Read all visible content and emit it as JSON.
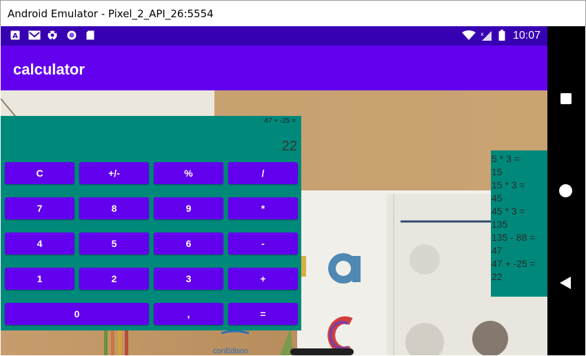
{
  "window": {
    "title": "Android Emulator - Pixel_2_API_26:5554"
  },
  "status_bar": {
    "time": "10:07",
    "icons": [
      "a-notification-icon",
      "mail-icon",
      "soccer-ball-icon",
      "circle-app-icon",
      "sd-card-icon",
      "wifi-icon",
      "no-signal-icon",
      "battery-icon"
    ]
  },
  "app_bar": {
    "title": "calculator"
  },
  "calculator": {
    "expression": "47 + -25 =",
    "result": "22",
    "buttons": {
      "clear": "C",
      "plus_minus": "+/-",
      "percent": "%",
      "divide": "/",
      "seven": "7",
      "eight": "8",
      "nine": "9",
      "multiply": "*",
      "four": "4",
      "five": "5",
      "six": "6",
      "minus": "-",
      "one": "1",
      "two": "2",
      "three": "3",
      "plus": "+",
      "zero": "0",
      "decimal": ",",
      "equals": "="
    }
  },
  "history": [
    "5 * 3 =",
    "15",
    "15 * 3 =",
    "45",
    "45 * 3 =",
    "135",
    "135 - 88 =",
    "47",
    "47 + -25 =",
    "22"
  ],
  "background": {
    "text_logo": "conEdison"
  },
  "colors": {
    "status_bar": "#3700b3",
    "app_bar": "#6200ee",
    "button": "#6200ee",
    "panel": "#00897b",
    "nav": "#000000"
  }
}
